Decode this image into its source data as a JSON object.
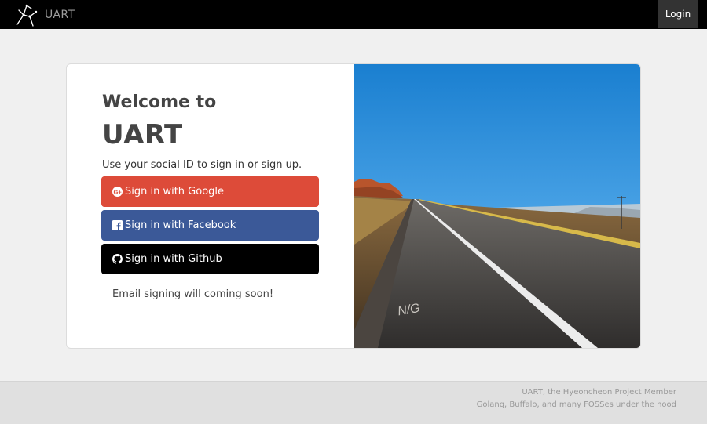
{
  "navbar": {
    "brand": "UART",
    "login_label": "Login"
  },
  "card": {
    "welcome": "Welcome to",
    "title": "UART",
    "subtitle": "Use your social ID to sign in or sign up.",
    "buttons": {
      "google": "Sign in with Google",
      "facebook": "Sign in with Facebook",
      "github": "Sign in with Github"
    },
    "note": "Email signing will coming soon!",
    "image_road_marking": "N/G"
  },
  "footer": {
    "line1": "UART, the Hyeoncheon Project Member",
    "line2": "Golang, Buffalo, and many FOSSes under the hood"
  },
  "icons": {
    "brand": "uart-logo-icon",
    "google": "google-plus-icon",
    "facebook": "facebook-icon",
    "github": "github-icon"
  },
  "colors": {
    "navbar": "#000000",
    "google": "#dd4b39",
    "facebook": "#3b5998",
    "github": "#000000",
    "background": "#f0f0f0",
    "footer": "#e0e0e0"
  }
}
